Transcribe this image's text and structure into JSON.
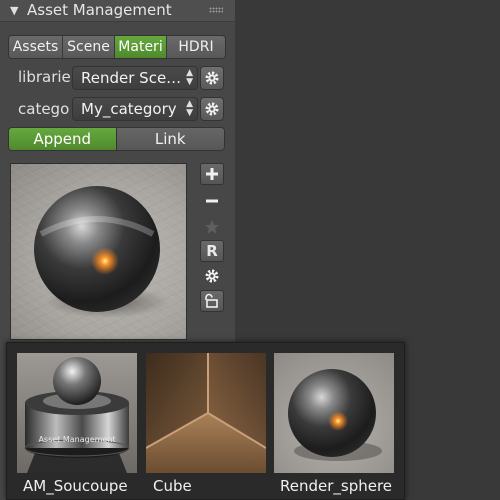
{
  "panel": {
    "title": "Asset Management",
    "tabs": [
      {
        "label": "Assets",
        "active": false
      },
      {
        "label": "Scene",
        "active": false
      },
      {
        "label": "Materi",
        "active": true
      },
      {
        "label": "HDRI",
        "active": false
      }
    ],
    "library": {
      "label": "librarie",
      "value": "Render Sce…"
    },
    "category": {
      "label": "catego",
      "value": "My_category"
    },
    "mode": {
      "append_label": "Append",
      "link_label": "Link",
      "active": "Append"
    },
    "side_tools": {
      "add_icon": "plus-icon",
      "remove_icon": "minus-icon",
      "favorite_icon": "star-icon",
      "render_label": "R",
      "settings_icon": "gear-icon",
      "lock_icon": "unlock-icon"
    }
  },
  "popup": {
    "items": [
      {
        "label": "AM_Soucoupe",
        "icon": "saucer-thumbnail",
        "engraving": "Asset Management"
      },
      {
        "label": "Cube",
        "icon": "cube-thumbnail"
      },
      {
        "label": "Render_sphere",
        "icon": "sphere-thumbnail"
      }
    ]
  },
  "colors": {
    "accent_green": "#5a9a35",
    "panel_bg": "#474747",
    "viewport_bg": "#393939",
    "popup_bg": "#2a2a2a"
  }
}
